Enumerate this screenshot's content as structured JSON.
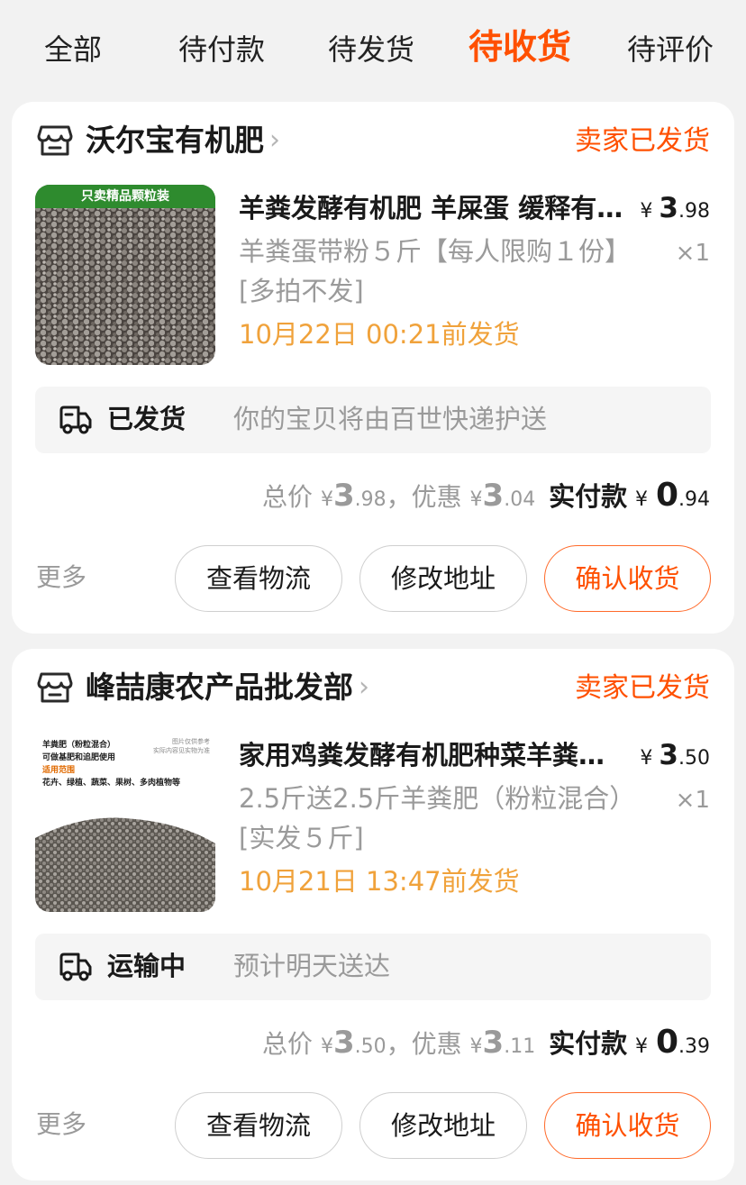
{
  "tabs": [
    {
      "label": "全部"
    },
    {
      "label": "待付款"
    },
    {
      "label": "待发货"
    },
    {
      "label": "待收货",
      "active": true
    },
    {
      "label": "待评价"
    }
  ],
  "accent_color": "#ff5000",
  "orders": [
    {
      "shop_name": "沃尔宝有机肥",
      "status": "卖家已发货",
      "product_title": "羊粪发酵有机肥 羊屎蛋 缓释有机肥料",
      "thumb_banner": "只卖精品颗粒装",
      "unit_price": {
        "yen": "¥",
        "int": "3",
        "dec": ".98"
      },
      "spec": "羊粪蛋带粉５斤【每人限购１份】[多拍不发]",
      "qty": "×1",
      "ship_by": "10月22日 00:21前发货",
      "logistics_status": "已发货",
      "logistics_desc": "你的宝贝将由百世快递护送",
      "total_label": "总价",
      "total": {
        "int": "3",
        "dec": ".98"
      },
      "discount_label": "，优惠",
      "discount": {
        "int": "3",
        "dec": ".04"
      },
      "paid_label": "实付款",
      "paid": {
        "int": "0",
        "dec": ".94"
      },
      "more_label": "更多",
      "buttons": {
        "track": "查看物流",
        "address": "修改地址",
        "confirm": "确认收货"
      }
    },
    {
      "shop_name": "峰喆康农产品批发部",
      "status": "卖家已发货",
      "product_title": "家用鸡粪发酵有机肥种菜羊粪有机肥",
      "thumb_lines": [
        "羊粪肥（粉粒混合）",
        "可做基肥和追肥使用",
        "适用范围",
        "花卉、绿植、蔬菜、果树、多肉植物等"
      ],
      "thumb_note": [
        "图片仅供参考",
        "实际内容见实物为准"
      ],
      "unit_price": {
        "yen": "¥",
        "int": "3",
        "dec": ".50"
      },
      "spec": "2.5斤送2.5斤羊粪肥（粉粒混合）[实发５斤]",
      "qty": "×1",
      "ship_by": "10月21日 13:47前发货",
      "logistics_status": "运输中",
      "logistics_desc": "预计明天送达",
      "total_label": "总价",
      "total": {
        "int": "3",
        "dec": ".50"
      },
      "discount_label": "，优惠",
      "discount": {
        "int": "3",
        "dec": ".11"
      },
      "paid_label": "实付款",
      "paid": {
        "int": "0",
        "dec": ".39"
      },
      "more_label": "更多",
      "buttons": {
        "track": "查看物流",
        "address": "修改地址",
        "confirm": "确认收货"
      }
    }
  ]
}
